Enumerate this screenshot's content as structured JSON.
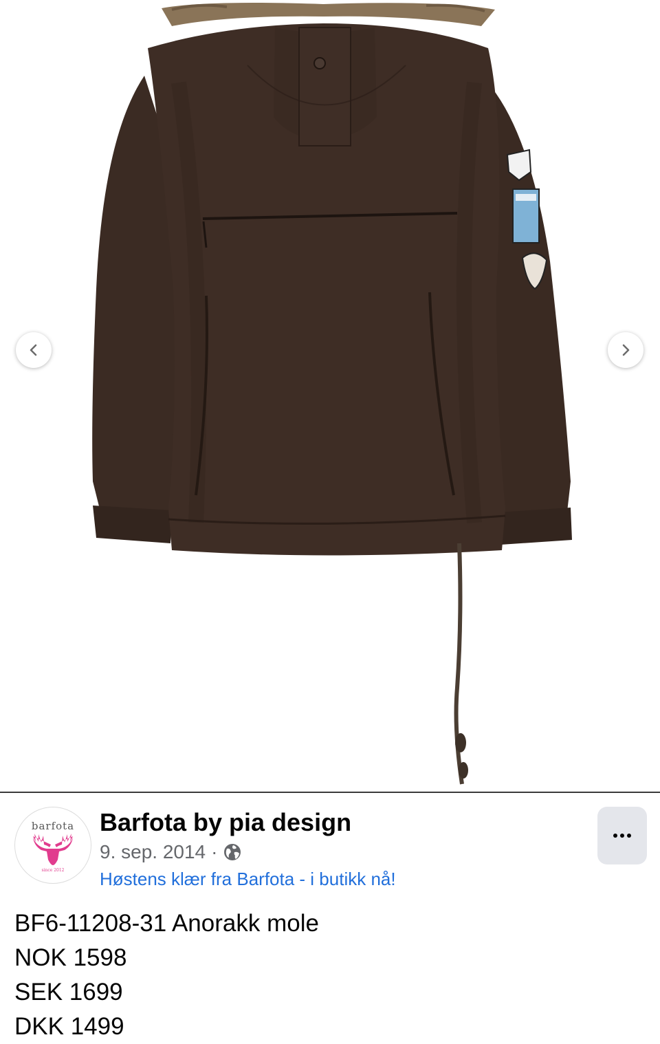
{
  "photo": {
    "alt": "Dark brown anorak with fur-trimmed hood, chest zip pocket, sleeve patches and drawstring hem",
    "colors": {
      "jacket": "#3a2a22",
      "fur": "#8a7458",
      "background": "#ffffff"
    }
  },
  "carousel": {
    "prev_icon": "chevron-left-icon",
    "next_icon": "chevron-right-icon"
  },
  "post": {
    "page_name": "Barfota by pia design",
    "date": "9. sep. 2014",
    "separator": "·",
    "audience_icon": "globe-icon",
    "album_link": "Høstens klær fra Barfota - i butikk nå!",
    "more_icon": "more-horizontal-icon",
    "avatar": {
      "wordmark": "barfota",
      "tagline": "since 2012",
      "logo_icon": "moose-icon",
      "logo_color": "#e13c8e"
    },
    "body_lines": [
      "BF6-11208-31 Anorakk mole",
      "NOK 1598",
      "SEK 1699",
      "DKK 1499"
    ]
  },
  "colors": {
    "link": "#216fdb",
    "secondary_text": "#65676b",
    "primary_text": "#050505",
    "more_button_bg": "#e4e6eb"
  }
}
